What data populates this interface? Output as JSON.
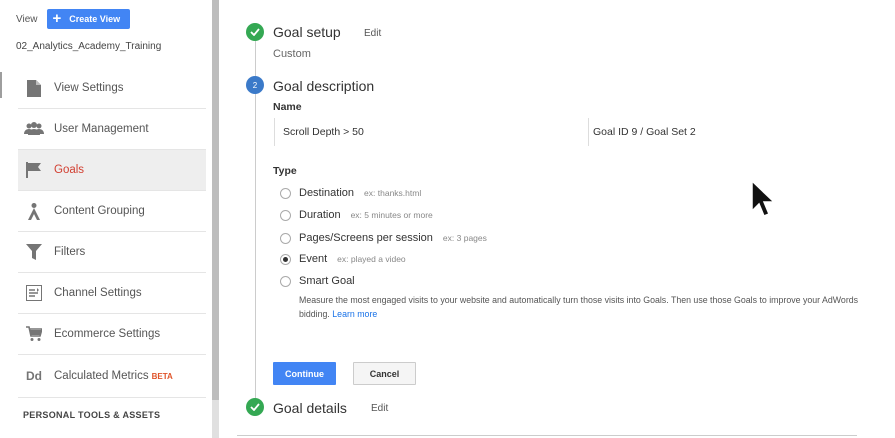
{
  "sidebar": {
    "view_label": "View",
    "create_view_label": "Create View",
    "view_name": "02_Analytics_Academy_Training",
    "items": [
      {
        "label": "View Settings",
        "icon": "document-icon"
      },
      {
        "label": "User Management",
        "icon": "users-icon"
      },
      {
        "label": "Goals",
        "icon": "flag-icon",
        "active": true
      },
      {
        "label": "Content Grouping",
        "icon": "person-icon"
      },
      {
        "label": "Filters",
        "icon": "filter-icon"
      },
      {
        "label": "Channel Settings",
        "icon": "channel-icon"
      },
      {
        "label": "Ecommerce Settings",
        "icon": "cart-icon"
      },
      {
        "label": "Calculated Metrics",
        "icon": "dd-icon",
        "badge": "BETA",
        "icon_text": "Dd"
      }
    ],
    "section_header": "PERSONAL TOOLS & ASSETS"
  },
  "goal_setup": {
    "title": "Goal setup",
    "edit_label": "Edit",
    "subtitle": "Custom"
  },
  "goal_description": {
    "step_number": "2",
    "title": "Goal description",
    "name_label": "Name",
    "name_value": "Scroll Depth > 50",
    "goal_id_value": "Goal ID 9 / Goal Set 2",
    "type_label": "Type",
    "types": [
      {
        "label": "Destination",
        "example": "ex: thanks.html",
        "checked": false
      },
      {
        "label": "Duration",
        "example": "ex: 5 minutes or more",
        "checked": false
      },
      {
        "label": "Pages/Screens per session",
        "example": "ex: 3 pages",
        "checked": false
      },
      {
        "label": "Event",
        "example": "ex: played a video",
        "checked": true
      },
      {
        "label": "Smart Goal",
        "example": "",
        "checked": false
      }
    ],
    "smart_goal_description": "Measure the most engaged visits to your website and automatically turn those visits into Goals. Then use those Goals to improve your AdWords bidding.",
    "learn_more_label": "Learn more",
    "continue_label": "Continue",
    "cancel_label": "Cancel"
  },
  "goal_details": {
    "title": "Goal details",
    "edit_label": "Edit"
  },
  "colors": {
    "primary_blue": "#4285f4",
    "success_green": "#34a853",
    "active_red": "#d23f31",
    "beta_orange": "#e0542a"
  }
}
